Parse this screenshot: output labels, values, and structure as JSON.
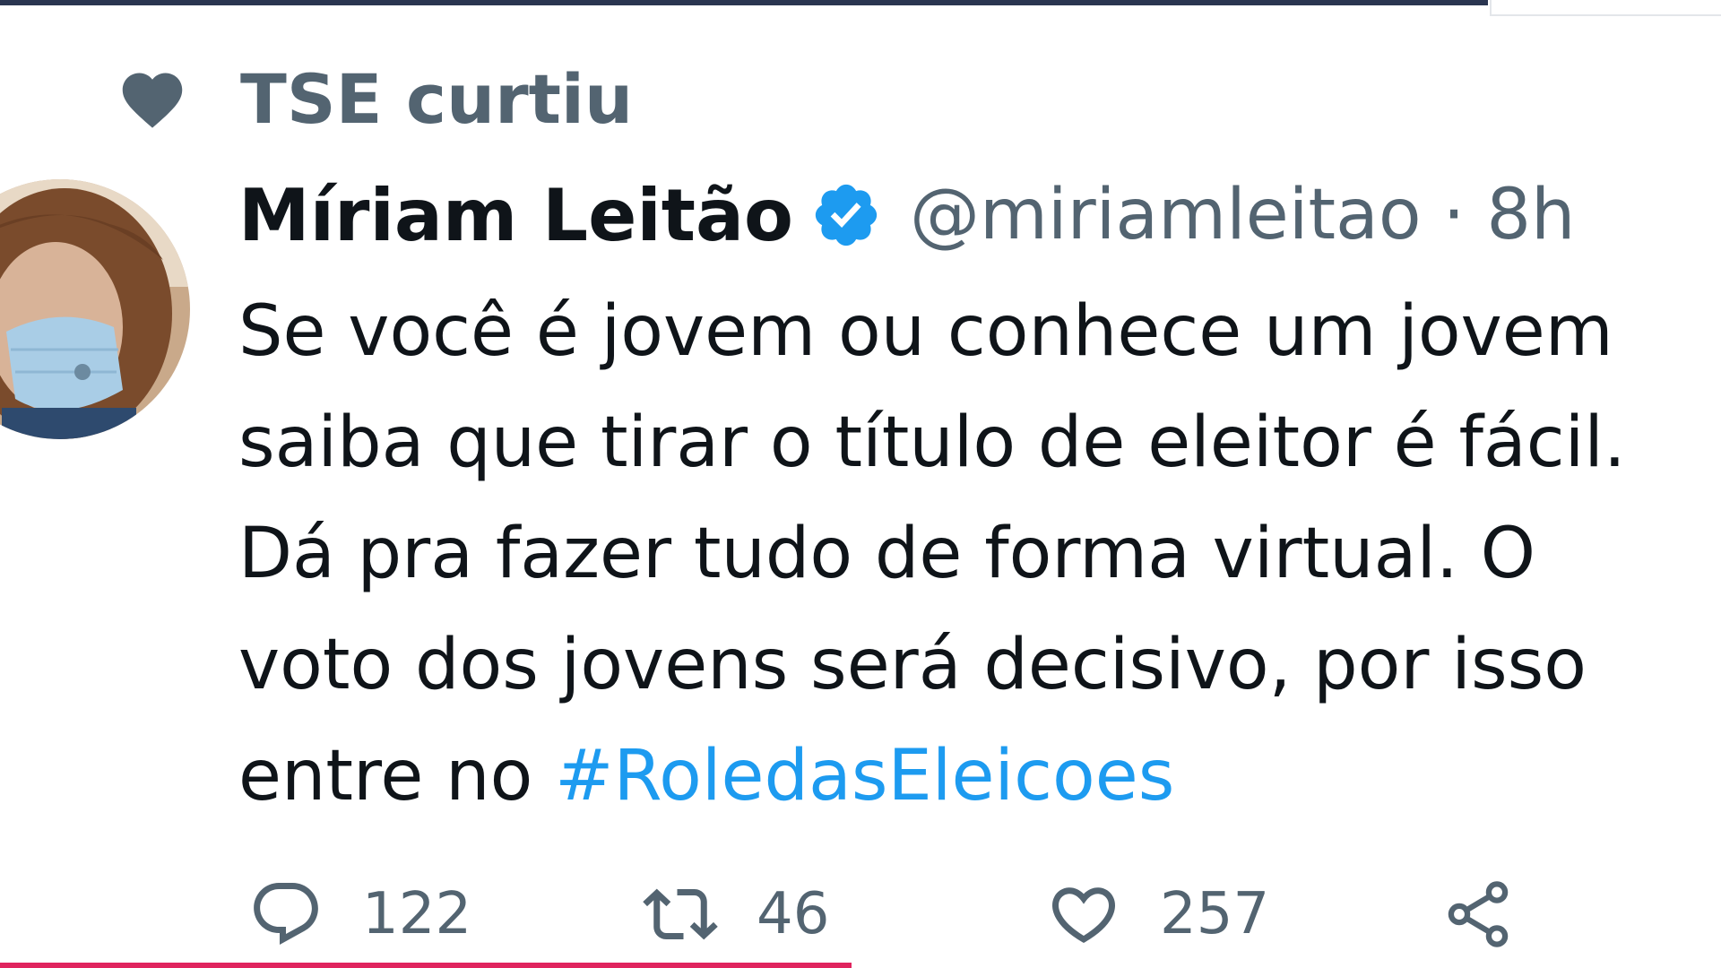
{
  "social_context": {
    "icon": "heart-filled-icon",
    "text": "TSE curtiu"
  },
  "tweet": {
    "author": {
      "display_name": "Míriam Leitão",
      "verified": true,
      "handle": "@miriamleitao",
      "separator": "·",
      "time": "8h",
      "avatar": "avatar-photo"
    },
    "text_lines": [
      "Se você é jovem ou conhece um jovem",
      "saiba que tirar o título de eleitor é fácil.",
      "Dá pra fazer tudo de forma virtual. O",
      "voto dos jovens será decisivo, por isso",
      "entre no "
    ],
    "hashtag": "#RoledasEleicoes",
    "actions": {
      "reply": {
        "icon": "reply-icon",
        "count": "122"
      },
      "retweet": {
        "icon": "retweet-icon",
        "count": "46"
      },
      "like": {
        "icon": "heart-outline-icon",
        "count": "257"
      },
      "share": {
        "icon": "share-icon"
      }
    }
  },
  "colors": {
    "primary_text": "#0f1419",
    "secondary_text": "#536471",
    "link": "#1d9bf0",
    "verified_badge": "#1d9bf0"
  }
}
